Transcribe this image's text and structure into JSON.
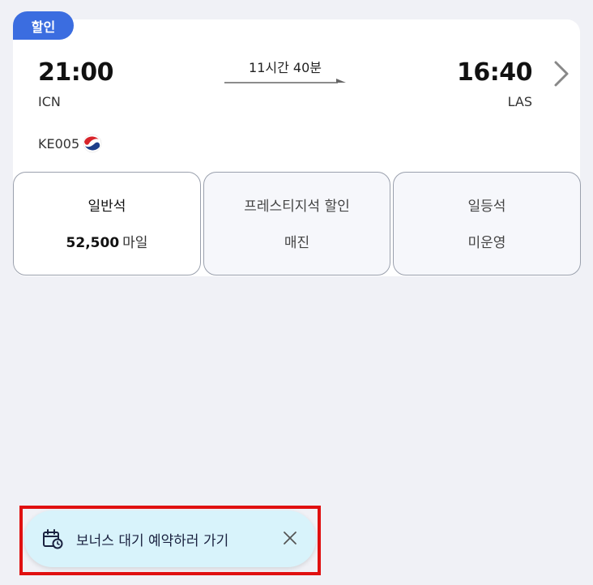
{
  "badge": {
    "label": "할인"
  },
  "flight": {
    "departure": {
      "time": "21:00",
      "code": "ICN"
    },
    "arrival": {
      "time": "16:40",
      "code": "LAS"
    },
    "duration": "11시간 40분",
    "number": "KE005",
    "airline_icon": "korean-air-logo"
  },
  "fares": [
    {
      "name": "일반석",
      "miles": "52,500",
      "unit": "마일"
    },
    {
      "name": "프레스티지석 할인",
      "status": "매진"
    },
    {
      "name": "일등석",
      "status": "미운영"
    }
  ],
  "toast": {
    "icon": "calendar-clock-icon",
    "label": "보너스 대기 예약하러 가기",
    "close_icon": "close-icon"
  },
  "colors": {
    "badge": "#3b6de0",
    "toast_bg": "#d8f3fb",
    "highlight": "#e01010",
    "page_bg": "#f0f1f6"
  }
}
